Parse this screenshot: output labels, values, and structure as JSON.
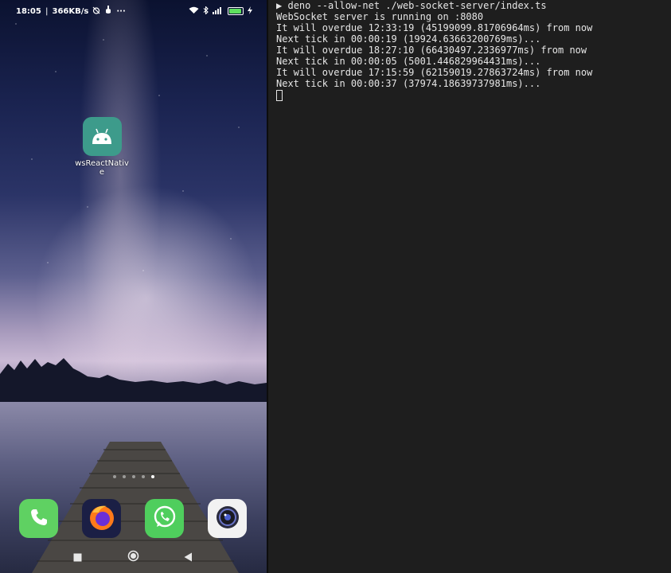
{
  "phone": {
    "status_bar": {
      "time": "18:05",
      "network_speed": "366KB/s",
      "battery_label": "96",
      "more_indicator": "···"
    },
    "home_app": {
      "label": "wsReactNative",
      "icon": "android-icon",
      "color": "#3d9b8b"
    },
    "dock": [
      {
        "name": "phone",
        "icon": "phone-icon",
        "color": "#5fd162"
      },
      {
        "name": "firefox",
        "icon": "firefox-icon",
        "color": "#1b1f45"
      },
      {
        "name": "whatsapp",
        "icon": "whatsapp-icon",
        "color": "#4fce5d"
      },
      {
        "name": "camera",
        "icon": "camera-icon",
        "color": "#f2f2f2"
      }
    ],
    "page_indicator": {
      "total": 5,
      "active_index": 4
    },
    "nav_bar": [
      "recents-button",
      "home-button",
      "back-button"
    ]
  },
  "terminal": {
    "prompt_symbol": "▶",
    "command": "deno --allow-net ./web-socket-server/index.ts",
    "output": [
      "WebSocket server is running on :8080",
      "It will overdue 12:33:19 (45199099.81706964ms) from now",
      "Next tick in 00:00:19 (19924.63663200769ms)...",
      "It will overdue 18:27:10 (66430497.2336977ms) from now",
      "Next tick in 00:00:05 (5001.446829964431ms)...",
      "It will overdue 17:15:59 (62159019.27863724ms) from now",
      "Next tick in 00:00:37 (37974.18639737981ms)..."
    ]
  }
}
